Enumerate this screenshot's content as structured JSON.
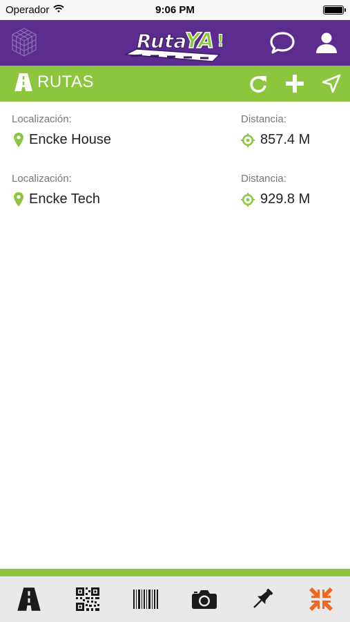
{
  "status_bar": {
    "carrier": "Operador",
    "time": "9:06 PM"
  },
  "header": {
    "logo_text_a": "Ruta",
    "logo_text_b": "YA"
  },
  "subbar": {
    "title": "RUTAS"
  },
  "routes": [
    {
      "location_label": "Localización:",
      "location": "Encke House",
      "distance_label": "Distancia:",
      "distance": "857.4 M"
    },
    {
      "location_label": "Localización:",
      "location": "Encke Tech",
      "distance_label": "Distancia:",
      "distance": "929.8 M"
    }
  ],
  "colors": {
    "purple": "#5b2d8e",
    "green": "#8cc63f",
    "orange": "#f26522",
    "tabbar": "#e9e9e9"
  },
  "tabbar": {
    "icons": [
      "road-icon",
      "qr-code-icon",
      "barcode-icon",
      "camera-icon",
      "pushpin-icon",
      "collapse-arrows-icon"
    ],
    "active": "collapse-arrows-icon"
  }
}
